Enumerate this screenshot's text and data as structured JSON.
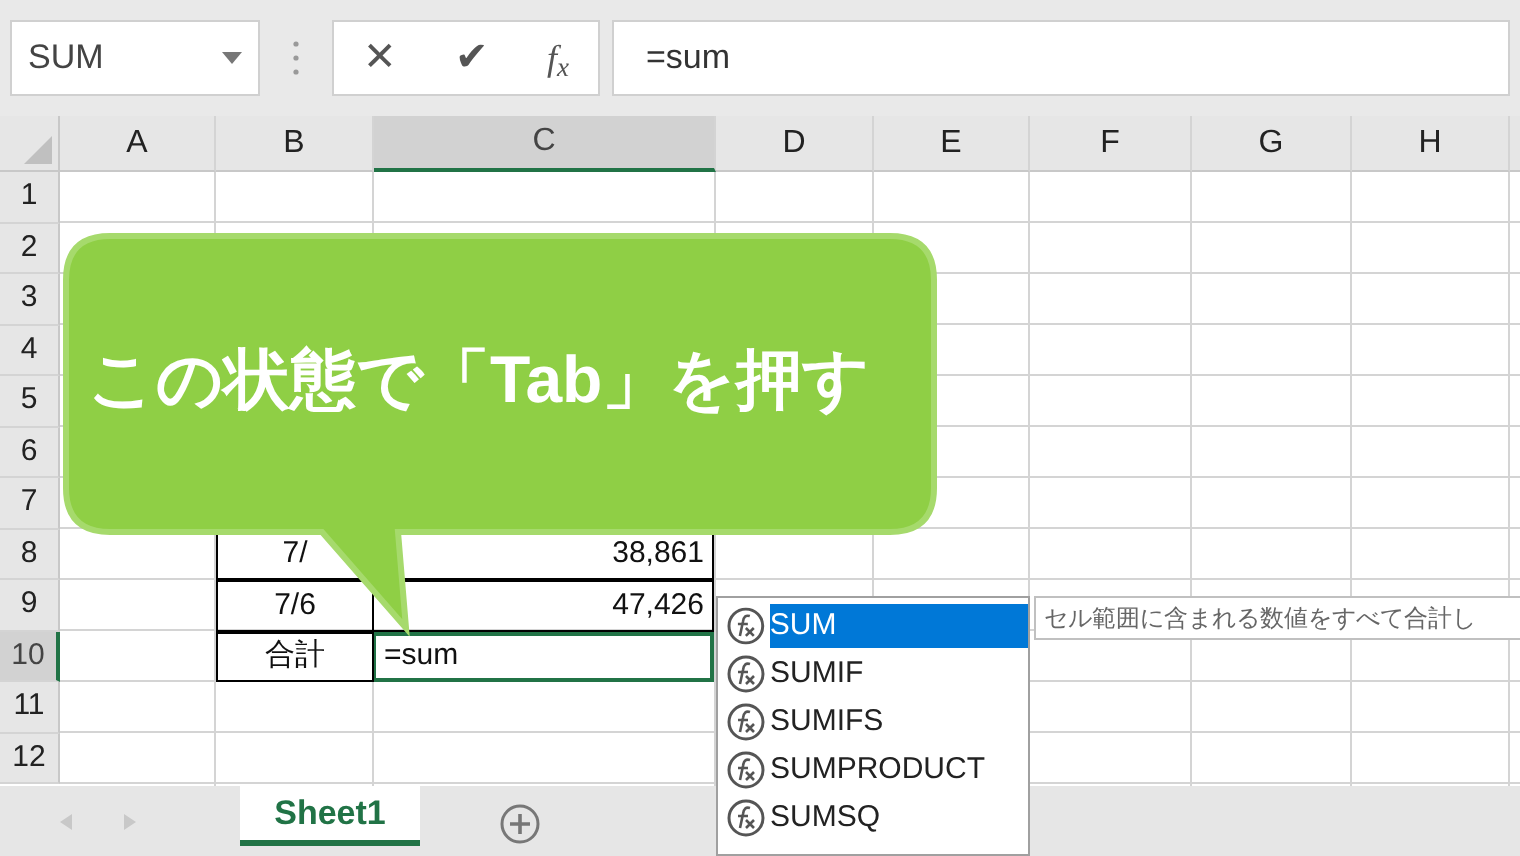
{
  "formula_bar": {
    "name_box": "SUM",
    "cancel_symbol": "✕",
    "enter_symbol": "✔",
    "function_symbol": "f$_{x}$",
    "formula": "=sum"
  },
  "columns": [
    {
      "label": "A",
      "selected": false
    },
    {
      "label": "B",
      "selected": false
    },
    {
      "label": "C",
      "selected": true
    },
    {
      "label": "D",
      "selected": false
    },
    {
      "label": "E",
      "selected": false
    },
    {
      "label": "F",
      "selected": false
    },
    {
      "label": "G",
      "selected": false
    },
    {
      "label": "H",
      "selected": false
    }
  ],
  "rows": [
    {
      "number": "1",
      "selected": false
    },
    {
      "number": "2",
      "selected": false
    },
    {
      "number": "3",
      "selected": false
    },
    {
      "number": "4",
      "selected": false
    },
    {
      "number": "5",
      "selected": false
    },
    {
      "number": "6",
      "selected": false
    },
    {
      "number": "7",
      "selected": false
    },
    {
      "number": "8",
      "selected": false,
      "B": "7/",
      "C": "38,861"
    },
    {
      "number": "9",
      "selected": false,
      "B": "7/6",
      "C": "47,426"
    },
    {
      "number": "10",
      "selected": true,
      "B": "合計",
      "C": "=sum"
    },
    {
      "number": "11",
      "selected": false
    },
    {
      "number": "12",
      "selected": false
    }
  ],
  "callout": {
    "text": "この状態で「Tab」を押す"
  },
  "autocomplete": {
    "items": [
      {
        "label": "SUM",
        "selected": true
      },
      {
        "label": "SUMIF",
        "selected": false
      },
      {
        "label": "SUMIFS",
        "selected": false
      },
      {
        "label": "SUMPRODUCT",
        "selected": false
      },
      {
        "label": "SUMSQ",
        "selected": false
      }
    ],
    "tooltip": "セル範囲に含まれる数値をすべて合計し"
  },
  "sheet_tabs": [
    {
      "label": "Sheet1",
      "selected": true
    }
  ]
}
